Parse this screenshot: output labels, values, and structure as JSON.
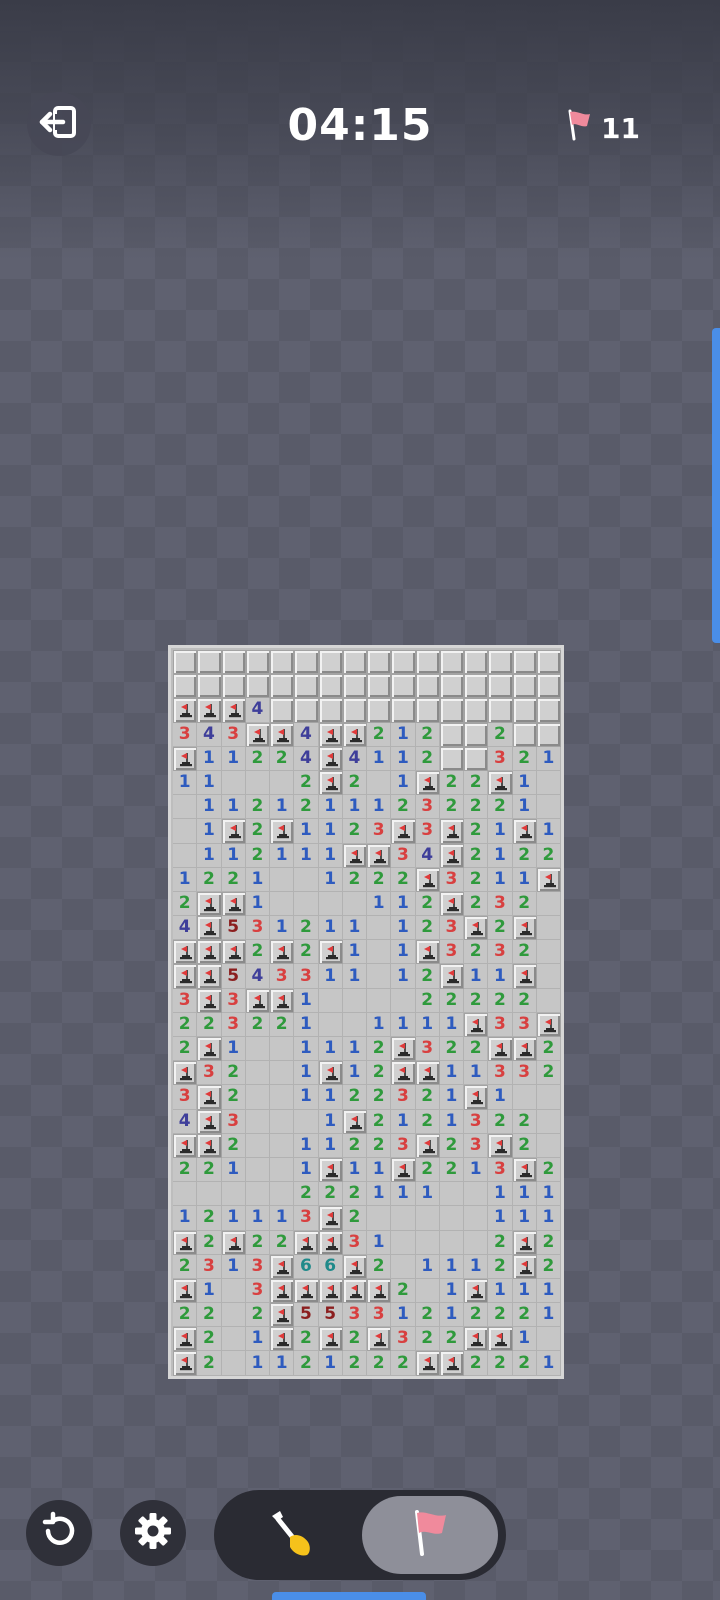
{
  "header": {
    "exit_icon": "exit-icon",
    "timer": "04:15",
    "flags_icon": "flag-icon",
    "flags_remaining": "11"
  },
  "board": {
    "cols": 16,
    "rows_count": 30,
    "legend": {
      "c": "covered",
      "o": "open-empty",
      "f": "flagged",
      "1-8": "number"
    },
    "rows": [
      "cccccccccccccccc",
      "cccccccccccccccc",
      "fff4cccccccccccc",
      "343ff4ff212cc2cc",
      "f11224f4112cc321",
      "11ooo2f2o1f22f1o",
      "o11212111232221",
      "o1f2f112 3f3f21f1",
      "o112111ff34f2122",
      "1221oo1222f3211f",
      "2ff1oooo11 2f232",
      "4f531211o12 3f2f",
      "fff2f2f1o1f3232",
      "ff5433 11o12f11f",
      "3f3ff1oooo 22222",
      "22322 1oo1111f33f",
      "2f1oo111 2f322ff2",
      "f32oo1f12ff1133 2",
      "3f2oo11 2232 1 f1",
      "4f3ooo1f212 1322",
      "ff2oo112 23f2 3f2",
      "221oo1f11f2213f2",
      "ooooo2 22111oo111",
      "1211 13f2ooooo111",
      "f2f22ff31oooo2f2",
      "231 3f66f2o1112f2",
      "f1o3fffff2o1f1111",
      "22o2f55331 2122 21",
      "f2o1f2f2f3 22ff1",
      "f2o11212 2 2ff2221"
    ]
  },
  "toolbar": {
    "restart_icon": "restart-icon",
    "settings_icon": "gear-icon",
    "dig_icon": "shovel-icon",
    "flag_mode_icon": "flag-icon",
    "active_mode": "flag"
  }
}
